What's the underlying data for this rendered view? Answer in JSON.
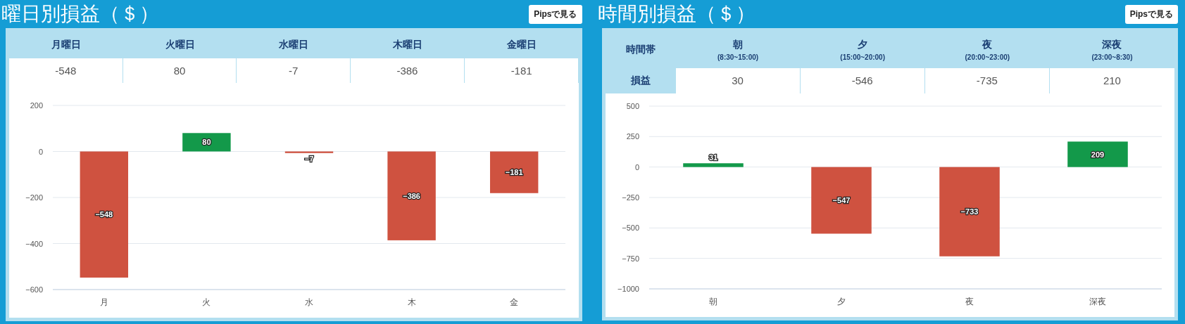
{
  "panels": [
    {
      "kind": "weekday",
      "title": "曜日別損益（＄）",
      "button": "Pipsで見る",
      "table": {
        "columns": [
          {
            "label": "月曜日"
          },
          {
            "label": "火曜日"
          },
          {
            "label": "水曜日"
          },
          {
            "label": "木曜日"
          },
          {
            "label": "金曜日"
          }
        ],
        "values": [
          "-548",
          "80",
          "-7",
          "-386",
          "-181"
        ]
      },
      "chart_data": {
        "type": "bar",
        "categories": [
          "月",
          "火",
          "水",
          "木",
          "金"
        ],
        "series": [
          {
            "color": "#13994a",
            "values": [
              null,
              80,
              null,
              null,
              null
            ]
          },
          {
            "color": "#cf5240",
            "values": [
              -548,
              null,
              -7,
              -386,
              -181
            ]
          }
        ],
        "stacked": true,
        "grid": true,
        "ylim": [
          -600,
          200
        ],
        "yticks": [
          {
            "value": -600,
            "label": "−600"
          },
          {
            "value": -400,
            "label": "−400"
          },
          {
            "value": -200,
            "label": "−200"
          },
          0,
          200
        ],
        "data_labels": true,
        "value_labels": [
          "−548",
          "80",
          "−7",
          "−386",
          "−181"
        ]
      }
    },
    {
      "kind": "time",
      "title": "時間別損益（＄）",
      "button": "Pipsで見る",
      "table": {
        "corner": "時間帯",
        "row_label": "損益",
        "columns": [
          {
            "label": "朝",
            "range": "(8:30~15:00)"
          },
          {
            "label": "夕",
            "range": "(15:00~20:00)"
          },
          {
            "label": "夜",
            "range": "(20:00~23:00)"
          },
          {
            "label": "深夜",
            "range": "(23:00~8:30)"
          }
        ],
        "values": [
          "30",
          "-546",
          "-735",
          "210"
        ]
      },
      "chart_data": {
        "type": "bar",
        "categories": [
          "朝",
          "夕",
          "夜",
          "深夜"
        ],
        "series": [
          {
            "color": "#13994a",
            "values": [
              31,
              null,
              null,
              209
            ]
          },
          {
            "color": "#cf5240",
            "values": [
              null,
              -547,
              -733,
              null
            ]
          }
        ],
        "stacked": true,
        "grid": true,
        "ylim": [
          -1000,
          500
        ],
        "yticks": [
          {
            "value": -1000,
            "label": "−1000"
          },
          {
            "value": -750,
            "label": "−750"
          },
          {
            "value": -500,
            "label": "−500"
          },
          {
            "value": -250,
            "label": "−250"
          },
          0,
          250,
          500
        ],
        "data_labels": true,
        "value_labels": [
          "31",
          "−547",
          "−733",
          "209"
        ]
      }
    }
  ]
}
